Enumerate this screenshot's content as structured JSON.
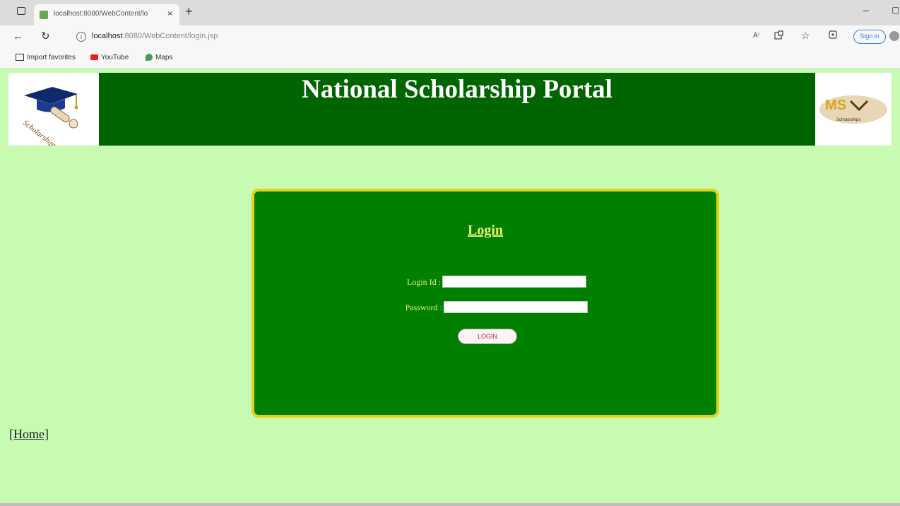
{
  "browser": {
    "tab_title": "localhost:8080/WebContent/lo",
    "tab_close": "×",
    "new_tab": "+",
    "minimize": "–",
    "maximize": "▢",
    "back": "←",
    "refresh": "↻",
    "info": "i",
    "url_host": "localhost",
    "url_rest": ":8080/WebContent/login.jsp",
    "read_aloud": "A⁾",
    "fav_star": "☆",
    "sign_in_label": "Sign in",
    "bookmarks": [
      {
        "label": "Import favorites"
      },
      {
        "label": "YouTube"
      },
      {
        "label": "Maps"
      }
    ]
  },
  "header": {
    "title": "National Scholarship Portal",
    "left_logo_text": "Scholarships",
    "right_logo_text": "Scholarships",
    "right_logo_mark": "MS"
  },
  "login": {
    "heading": "Login",
    "login_id_label": "Login Id :",
    "login_id_value": "",
    "password_label": "Password :",
    "password_value": "",
    "button_label": "LOGIN"
  },
  "footer": {
    "home_link": "[Home]"
  },
  "colors": {
    "page_bg": "#c6fbb1",
    "header_bg": "#006400",
    "login_bg": "#008000",
    "login_border": "#e0d219",
    "label_color": "#e8f06a"
  }
}
